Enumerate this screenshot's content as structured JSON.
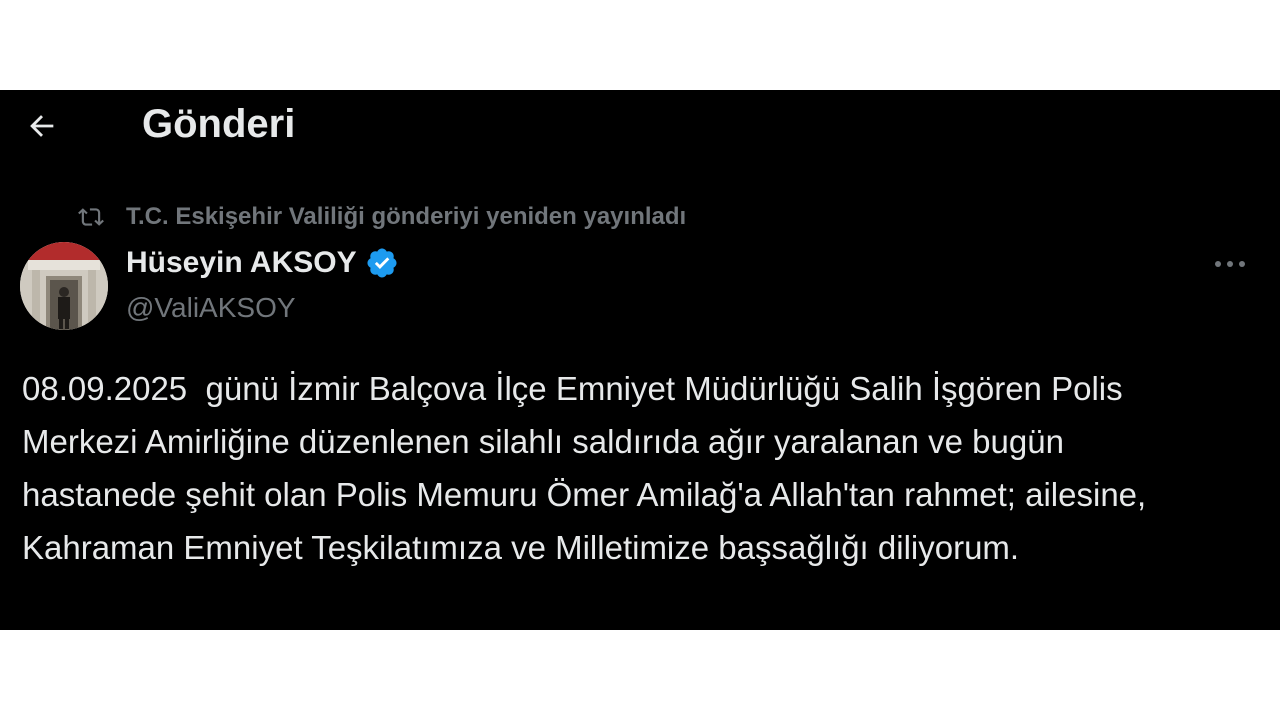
{
  "header": {
    "back_icon": "arrow-left-icon",
    "title": "Gönderi"
  },
  "repost": {
    "icon": "repost-icon",
    "text": "T.C. Eskişehir Valiliği gönderiyi yeniden yayınladı"
  },
  "author": {
    "name": "Hüseyin AKSOY",
    "handle": "@ValiAKSOY",
    "verified": true,
    "verified_color": "#1d9bf0",
    "avatar_icon": "profile-photo"
  },
  "more_icon": "more-dots-icon",
  "tweet": {
    "text": "08.09.2025  günü İzmir Balçova İlçe Emniyet Müdürlüğü Salih İşgören Polis Merkezi Amirliğine düzenlenen silahlı saldırıda ağır yaralanan ve bugün hastanede şehit olan Polis Memuru Ömer Amilağ'a Allah'tan rahmet; ailesine, Kahraman Emniyet Teşkilatımıza ve Milletimize başsağlığı diliyorum."
  },
  "colors": {
    "background": "#000000",
    "text_primary": "#e7e9ea",
    "text_secondary": "#71767b",
    "accent": "#1d9bf0"
  }
}
